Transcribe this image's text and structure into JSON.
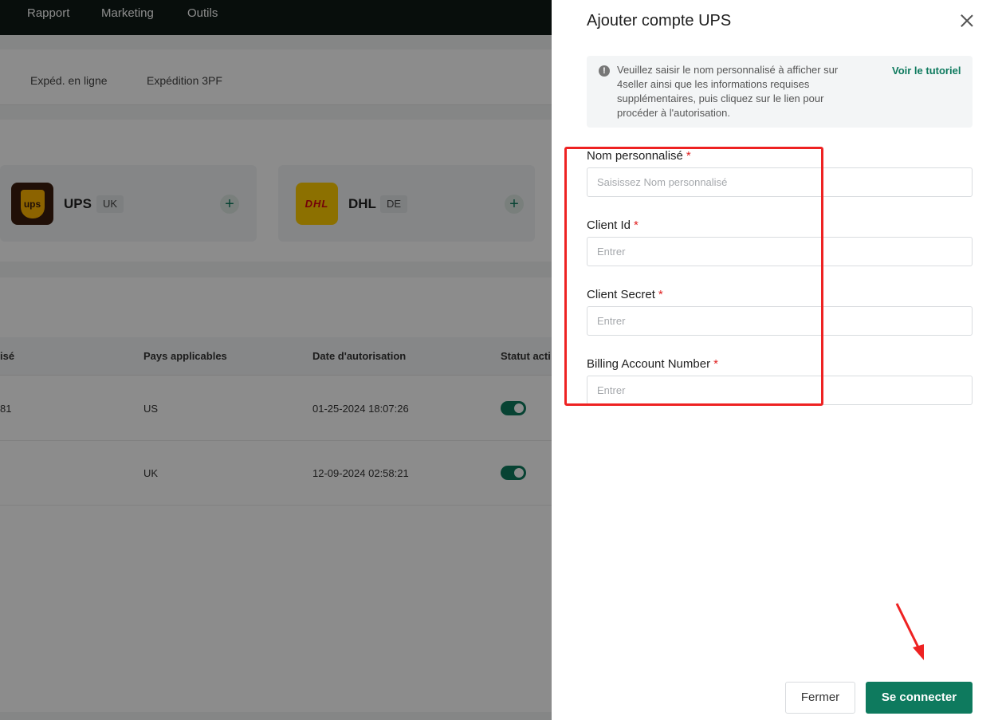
{
  "topnav": {
    "items": [
      "Rapport",
      "Marketing",
      "Outils"
    ]
  },
  "tabs": [
    "Expéd. en ligne",
    "Expédition 3PF"
  ],
  "carriers": [
    {
      "name": "UPS",
      "country": "UK",
      "logo_text": "ups"
    },
    {
      "name": "DHL",
      "country": "DE",
      "logo_text": "DHL"
    }
  ],
  "table": {
    "headers": [
      "isé",
      "Pays applicables",
      "Date d'autorisation",
      "Statut acti"
    ],
    "rows": [
      {
        "name": "81",
        "country": "US",
        "date": "01-25-2024 18:07:26"
      },
      {
        "name": "",
        "country": "UK",
        "date": "12-09-2024 02:58:21"
      }
    ]
  },
  "drawer": {
    "title": "Ajouter compte UPS",
    "info_text": "Veuillez saisir le nom personnalisé à afficher sur 4seller ainsi que les informations requises supplémentaires, puis cliquez sur le lien pour procéder à l'autorisation.",
    "tutorial_link": "Voir le tutoriel",
    "required_mark": "*",
    "fields": [
      {
        "label": "Nom personnalisé",
        "placeholder": "Saisissez Nom personnalisé",
        "value": ""
      },
      {
        "label": "Client Id",
        "placeholder": "Entrer",
        "value": ""
      },
      {
        "label": "Client Secret",
        "placeholder": "Entrer",
        "value": ""
      },
      {
        "label": "Billing Account Number",
        "placeholder": "Entrer",
        "value": ""
      }
    ],
    "cancel_label": "Fermer",
    "connect_label": "Se connecter"
  },
  "colors": {
    "accent": "#0e7a5e",
    "required": "#e02020",
    "annotation": "#ee2222",
    "topnav_bg": "#0f1a17"
  }
}
